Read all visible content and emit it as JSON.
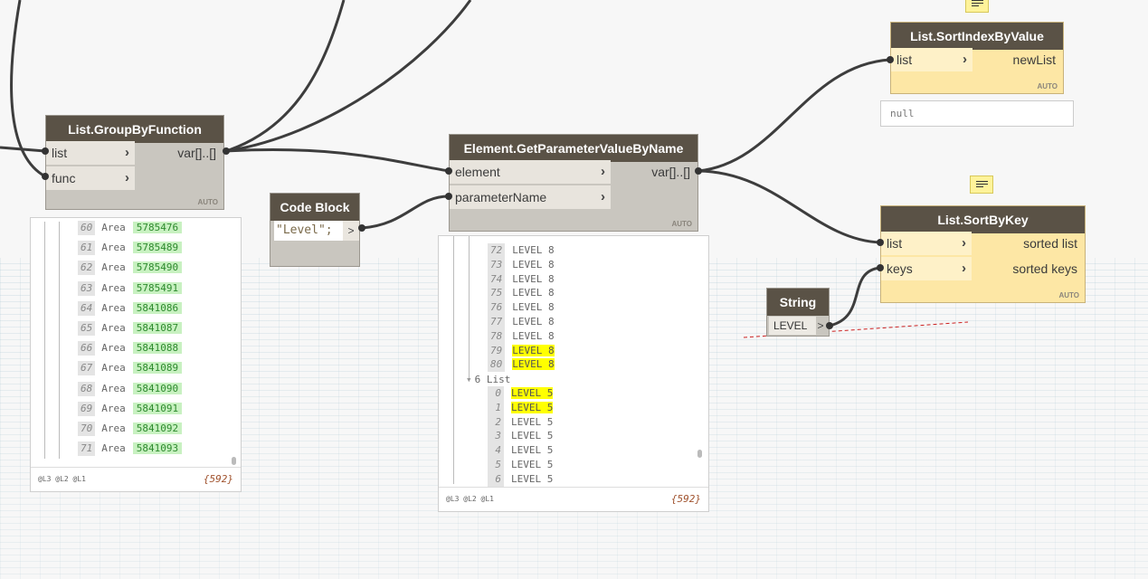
{
  "nodes": {
    "group_by_function": {
      "title": "List.GroupByFunction",
      "inputs": [
        "list",
        "func"
      ],
      "output": "var[]..[]",
      "lacing": "AUTO"
    },
    "get_parameter": {
      "title": "Element.GetParameterValueByName",
      "inputs": [
        "element",
        "parameterName"
      ],
      "output": "var[]..[]",
      "lacing": "AUTO"
    },
    "code_block": {
      "title": "Code Block",
      "code": "\"Level\";",
      "output": ">"
    },
    "sort_index": {
      "title": "List.SortIndexByValue",
      "input": "list",
      "output": "newList",
      "lacing": "AUTO",
      "preview": "null"
    },
    "sort_by_key": {
      "title": "List.SortByKey",
      "inputs": [
        "list",
        "keys"
      ],
      "outputs": [
        "sorted list",
        "sorted keys"
      ],
      "lacing": "AUTO"
    },
    "string": {
      "title": "String",
      "value": "LEVEL",
      "output": ">"
    }
  },
  "watch_left": {
    "rows": [
      {
        "i": "60",
        "t": "Area",
        "v": "5785476"
      },
      {
        "i": "61",
        "t": "Area",
        "v": "5785489"
      },
      {
        "i": "62",
        "t": "Area",
        "v": "5785490"
      },
      {
        "i": "63",
        "t": "Area",
        "v": "5785491"
      },
      {
        "i": "64",
        "t": "Area",
        "v": "5841086"
      },
      {
        "i": "65",
        "t": "Area",
        "v": "5841087"
      },
      {
        "i": "66",
        "t": "Area",
        "v": "5841088"
      },
      {
        "i": "67",
        "t": "Area",
        "v": "5841089"
      },
      {
        "i": "68",
        "t": "Area",
        "v": "5841090"
      },
      {
        "i": "69",
        "t": "Area",
        "v": "5841091"
      },
      {
        "i": "70",
        "t": "Area",
        "v": "5841092"
      },
      {
        "i": "71",
        "t": "Area",
        "v": "5841093"
      }
    ],
    "levels": "@L3 @L2 @L1",
    "count": "{592}"
  },
  "watch_mid": {
    "rows_a": [
      {
        "i": "72",
        "v": "LEVEL 8",
        "hl": false
      },
      {
        "i": "73",
        "v": "LEVEL 8",
        "hl": false
      },
      {
        "i": "74",
        "v": "LEVEL 8",
        "hl": false
      },
      {
        "i": "75",
        "v": "LEVEL 8",
        "hl": false
      },
      {
        "i": "76",
        "v": "LEVEL 8",
        "hl": false
      },
      {
        "i": "77",
        "v": "LEVEL 8",
        "hl": false
      },
      {
        "i": "78",
        "v": "LEVEL 8",
        "hl": false
      },
      {
        "i": "79",
        "v": "LEVEL 8",
        "hl": true
      },
      {
        "i": "80",
        "v": "LEVEL 8",
        "hl": true
      }
    ],
    "group_label": "6 List",
    "rows_b": [
      {
        "i": "0",
        "v": "LEVEL 5",
        "hl": true
      },
      {
        "i": "1",
        "v": "LEVEL 5",
        "hl": true
      },
      {
        "i": "2",
        "v": "LEVEL 5",
        "hl": false
      },
      {
        "i": "3",
        "v": "LEVEL 5",
        "hl": false
      },
      {
        "i": "4",
        "v": "LEVEL 5",
        "hl": false
      },
      {
        "i": "5",
        "v": "LEVEL 5",
        "hl": false
      },
      {
        "i": "6",
        "v": "LEVEL 5",
        "hl": false
      }
    ],
    "levels": "@L3 @L2 @L1",
    "count": "{592}"
  },
  "colors": {
    "node_header": "#5a5246",
    "node_body": "#c9c6bf",
    "selected_node": "#fde7a5",
    "highlight": "#ffff00",
    "number_chip": "#c8f1c1"
  },
  "icons": [
    "note-icon",
    "chevron-right-icon",
    "expand-triangle-icon"
  ]
}
